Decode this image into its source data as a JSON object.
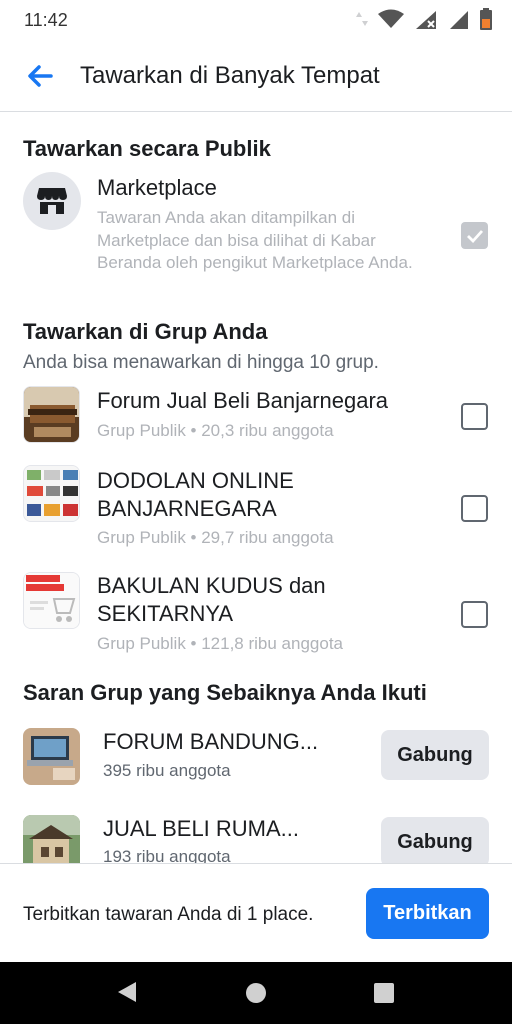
{
  "status_bar": {
    "time": "11:42"
  },
  "header": {
    "title": "Tawarkan di Banyak Tempat"
  },
  "public_section": {
    "title": "Tawarkan secara Publik",
    "marketplace": {
      "title": "Marketplace",
      "description": "Tawaran Anda akan ditampilkan di Marketplace dan bisa dilihat di Kabar Beranda oleh pengikut Marketplace Anda.",
      "checked": true
    }
  },
  "groups_section": {
    "title": "Tawarkan di Grup Anda",
    "subtitle": "Anda bisa menawarkan di hingga 10 grup.",
    "groups": [
      {
        "name": "Forum Jual Beli Banjarnegara",
        "meta": "Grup Publik • 20,3 ribu anggota",
        "checked": false
      },
      {
        "name": "DODOLAN ONLINE BANJARNEGARA",
        "meta": "Grup Publik • 29,7 ribu anggota",
        "checked": false
      },
      {
        "name": "BAKULAN KUDUS dan SEKITARNYA",
        "meta": "Grup Publik • 121,8 ribu anggota",
        "checked": false
      }
    ]
  },
  "suggest_section": {
    "title": "Saran Grup yang Sebaiknya Anda Ikuti",
    "groups": [
      {
        "name": "FORUM BANDUNG...",
        "meta": "395 ribu anggota",
        "button": "Gabung"
      },
      {
        "name": "JUAL BELI RUMA...",
        "meta": "193 ribu anggota",
        "button": "Gabung"
      }
    ]
  },
  "footer": {
    "summary": "Terbitkan tawaran Anda di 1 place.",
    "publish_label": "Terbitkan"
  },
  "colors": {
    "accent": "#1877f2",
    "muted": "#b0b3b8",
    "secondary": "#606770"
  }
}
